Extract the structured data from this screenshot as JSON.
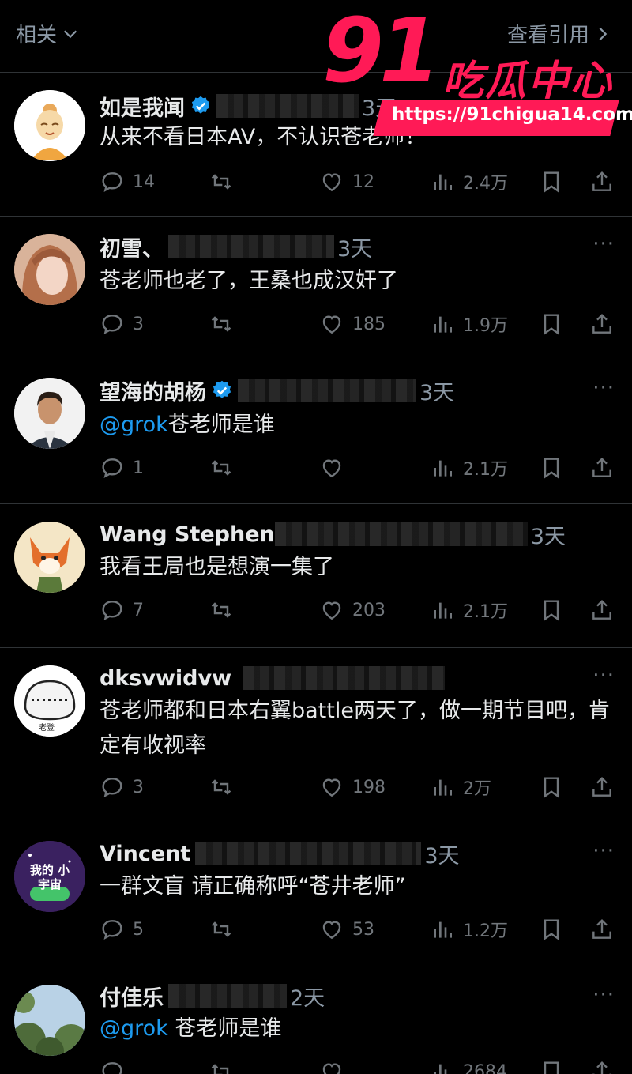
{
  "topbar": {
    "left_label": "相关",
    "right_label": "查看引用"
  },
  "watermark": {
    "number": "91",
    "name": "吃瓜中心",
    "url": "https://91chigua14.com"
  },
  "replies": [
    {
      "name": "如是我闻",
      "verified": true,
      "time": "3天",
      "text": "从来不看日本AV，不认识苍老师！",
      "mention": "",
      "comments": "14",
      "retweets": "",
      "likes": "12",
      "views": "2.4万"
    },
    {
      "name": "初雪、",
      "verified": false,
      "time": "3天",
      "text": "苍老师也老了，王桑也成汉奸了",
      "mention": "",
      "comments": "3",
      "retweets": "",
      "likes": "185",
      "views": "1.9万"
    },
    {
      "name": "望海的胡杨",
      "verified": true,
      "time": "3天",
      "text": "苍老师是谁",
      "mention": "@grok",
      "comments": "1",
      "retweets": "",
      "likes": "",
      "views": "2.1万"
    },
    {
      "name": "Wang Stephen",
      "verified": false,
      "time": "3天",
      "text": "我看王局也是想演一集了",
      "mention": "",
      "comments": "7",
      "retweets": "",
      "likes": "203",
      "views": "2.1万"
    },
    {
      "name": "dksvwidvw",
      "verified": false,
      "time": "",
      "text": "苍老师都和日本右翼battle两天了，做一期节目吧，肯定有收视率",
      "mention": "",
      "comments": "3",
      "retweets": "",
      "likes": "198",
      "views": "2万"
    },
    {
      "name": "Vincent",
      "verified": false,
      "time": "3天",
      "text": "一群文盲 请正确称呼“苍井老师”",
      "mention": "",
      "comments": "5",
      "retweets": "",
      "likes": "53",
      "views": "1.2万"
    },
    {
      "name": "付佳乐",
      "verified": false,
      "time": "2天",
      "text": " 苍老师是谁",
      "mention": "@grok",
      "comments": "",
      "retweets": "",
      "likes": "",
      "views": "2684"
    }
  ],
  "avatar_labels": {
    "vincent": "我的 小宇宙",
    "dksvwidvw": "老登"
  },
  "more_label": "···",
  "colors": {
    "background": "#000000",
    "accent": "#1d9bf0",
    "watermark": "#ff1a56",
    "muted": "#71767b"
  }
}
